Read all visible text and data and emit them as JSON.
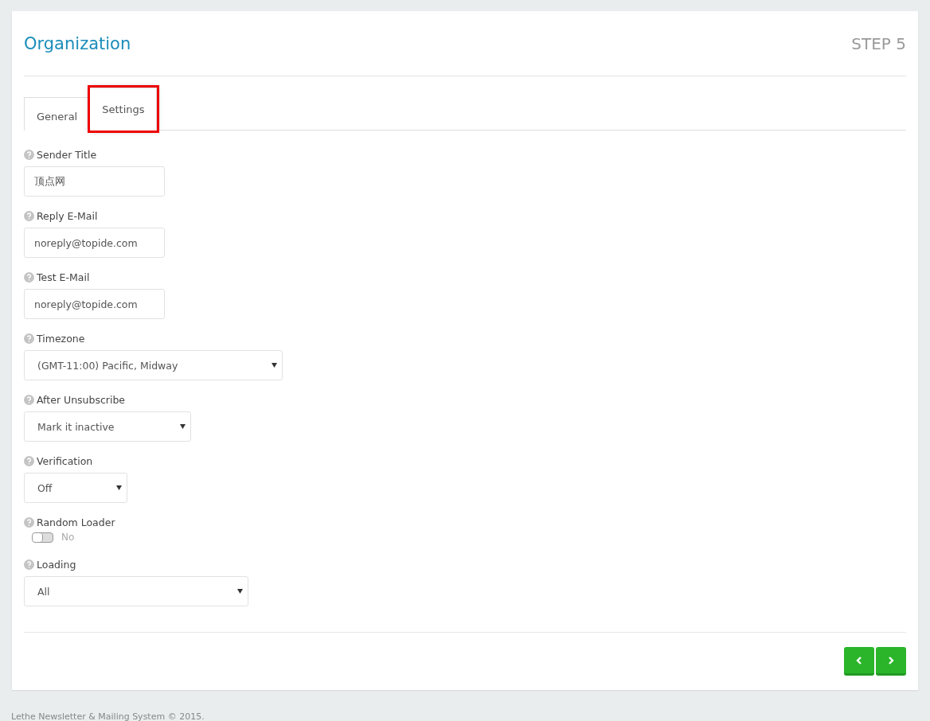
{
  "header": {
    "title": "Organization",
    "step": "STEP 5"
  },
  "tabs": [
    {
      "label": "General",
      "selected": false,
      "highlighted": false
    },
    {
      "label": "Settings",
      "selected": true,
      "highlighted": true
    }
  ],
  "fields": [
    {
      "kind": "text",
      "label": "Sender Title",
      "value": "顶点网"
    },
    {
      "kind": "text",
      "label": "Reply E-Mail",
      "value": "noreply@topide.com"
    },
    {
      "kind": "text",
      "label": "Test E-Mail",
      "value": "noreply@topide.com"
    },
    {
      "kind": "select",
      "label": "Timezone",
      "value": "(GMT-11:00) Pacific, Midway"
    },
    {
      "kind": "select",
      "label": "After Unsubscribe",
      "value": "Mark it inactive"
    },
    {
      "kind": "select",
      "label": "Verification",
      "value": "Off"
    },
    {
      "kind": "toggle",
      "label": "Random Loader",
      "on": false,
      "value": "No"
    },
    {
      "kind": "select",
      "label": "Loading",
      "value": "All"
    }
  ],
  "footer": "Lethe Newsletter & Mailing System © 2015."
}
